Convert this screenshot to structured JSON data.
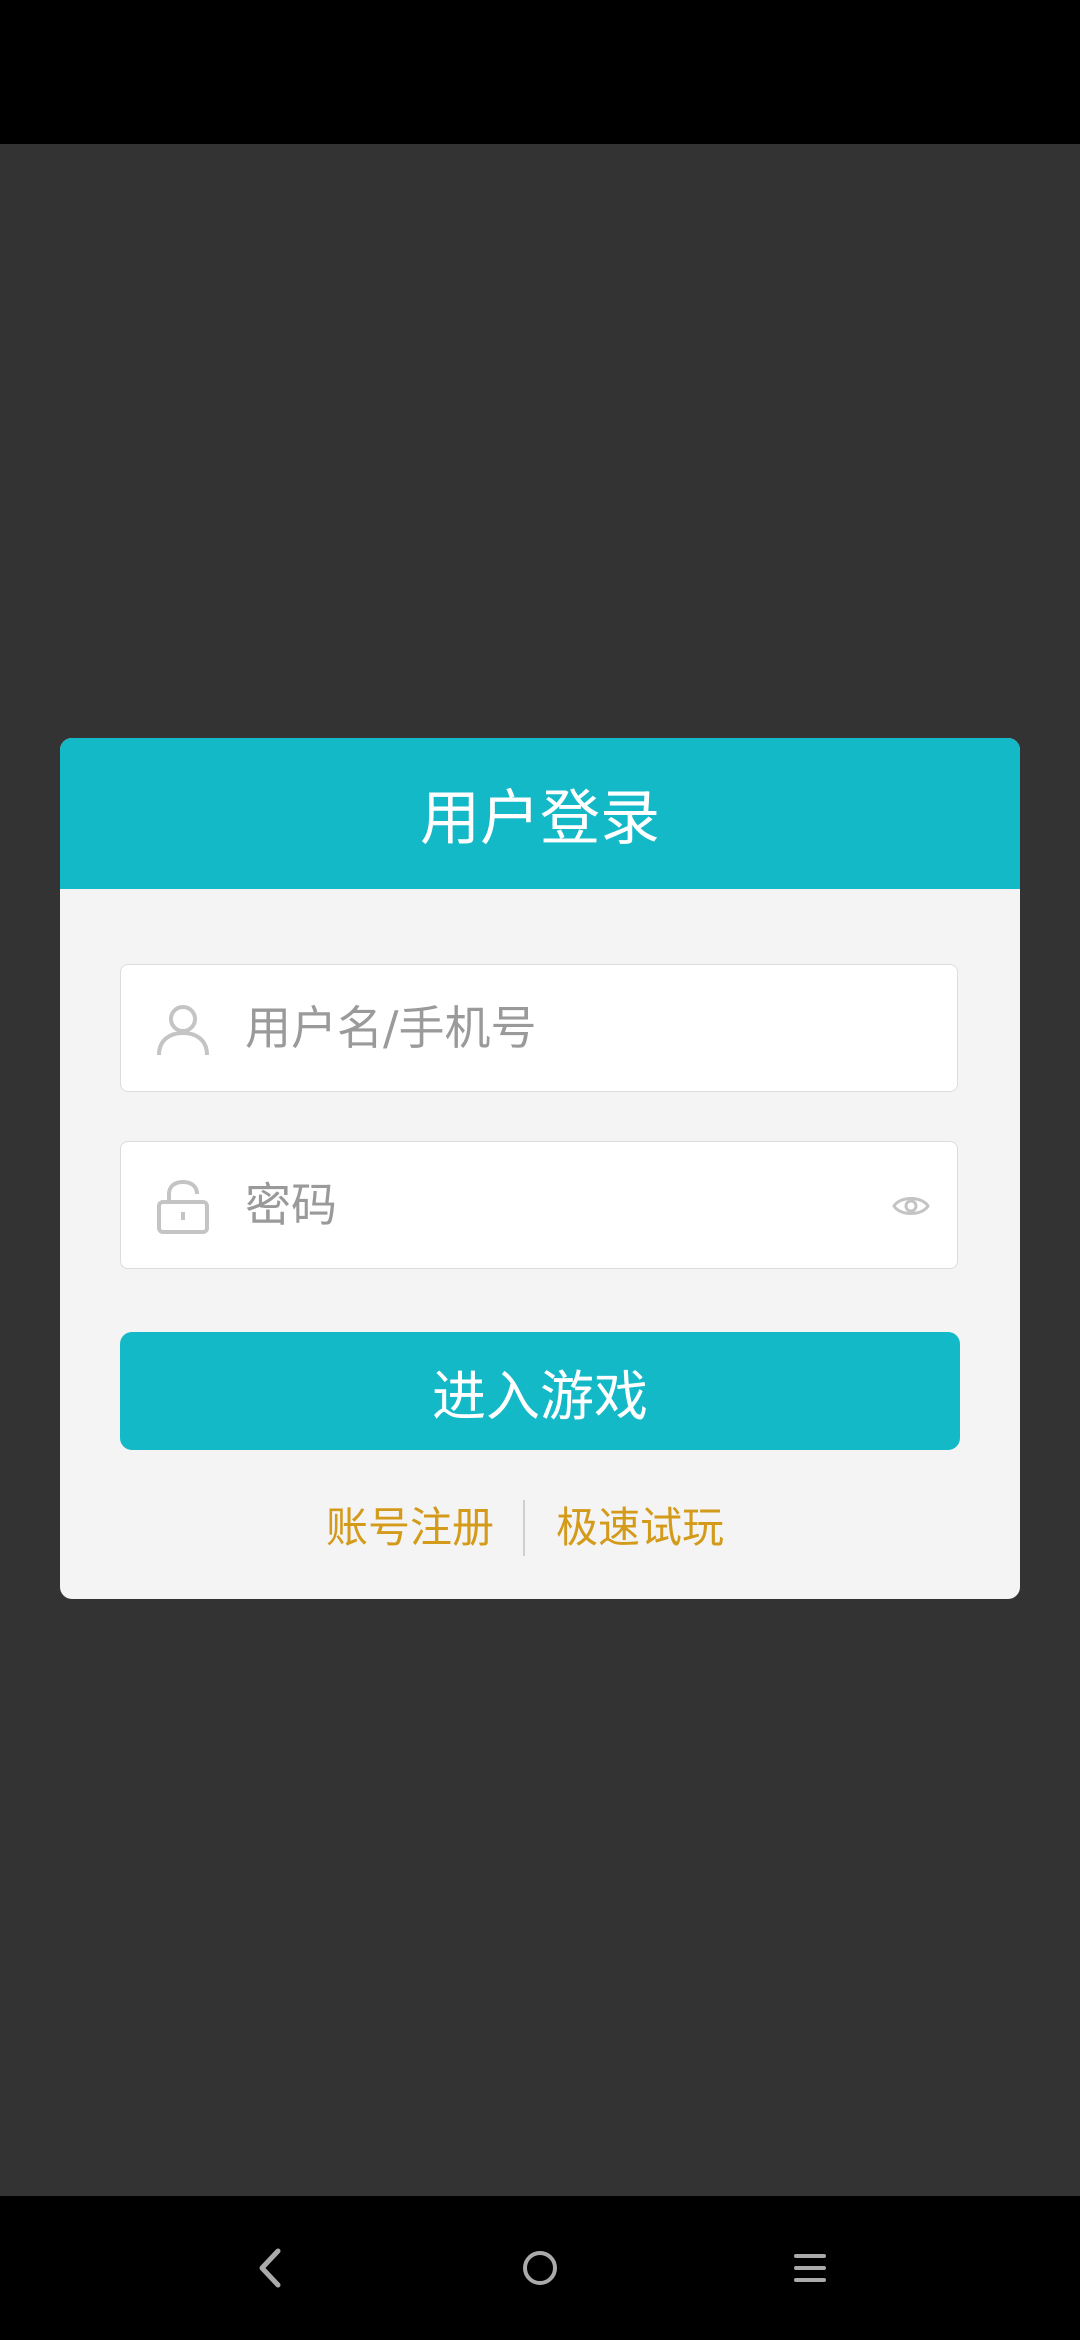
{
  "colors": {
    "accent": "#14b9c8",
    "link": "#d49a1a",
    "icon_gray": "#c4c4c4"
  },
  "dialog": {
    "title": "用户登录",
    "username": {
      "icon": "user-icon",
      "placeholder": "用户名/手机号",
      "value": ""
    },
    "password": {
      "icon": "lock-icon",
      "placeholder": "密码",
      "value": "",
      "toggle_icon": "eye-icon"
    },
    "submit_label": "进入游戏",
    "register_label": "账号注册",
    "quick_play_label": "极速试玩"
  },
  "navigation": {
    "back_icon": "back-icon",
    "home_icon": "home-icon",
    "menu_icon": "menu-icon"
  }
}
